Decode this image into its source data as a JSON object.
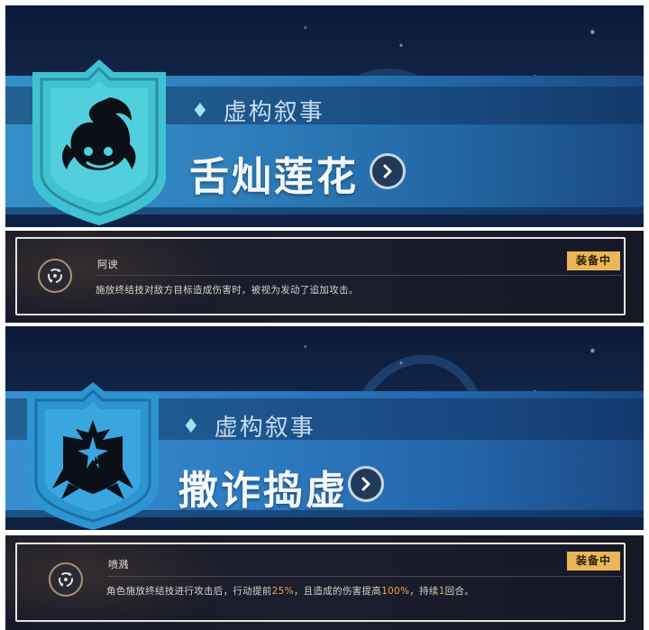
{
  "colors": {
    "accent_gold": "#e9b758",
    "highlight_orange": "#e9a94a",
    "band_blue": "#2f80bd",
    "shield_cyan": "#3fc3d3",
    "shield_blue": "#2d95d1"
  },
  "panels": [
    {
      "category_icon": "diamond-icon",
      "category": "虚构叙事",
      "relic_name": "舌灿莲花",
      "emblem_icon": "flame-swirl-emblem-icon",
      "chevron_icon": "chevron-right-icon",
      "effect": {
        "icon": "cycle-arrows-icon",
        "name": "阿谀",
        "badge": "装备中",
        "description": "施放终结技对敌方目标造成伤害时，被视为发动了追加攻击。"
      }
    },
    {
      "category_icon": "diamond-icon",
      "category": "虚构叙事",
      "relic_name": "撒诈捣虚",
      "emblem_icon": "spiked-star-emblem-icon",
      "chevron_icon": "chevron-right-icon",
      "effect": {
        "icon": "cycle-arrows-icon",
        "name": "喷溅",
        "badge": "装备中",
        "description_parts": [
          "角色施放终结技进行攻击后，行动提前",
          "25%",
          "，且造成的伤害提高",
          "100%",
          "，持续",
          "1",
          "回合。"
        ]
      }
    }
  ]
}
